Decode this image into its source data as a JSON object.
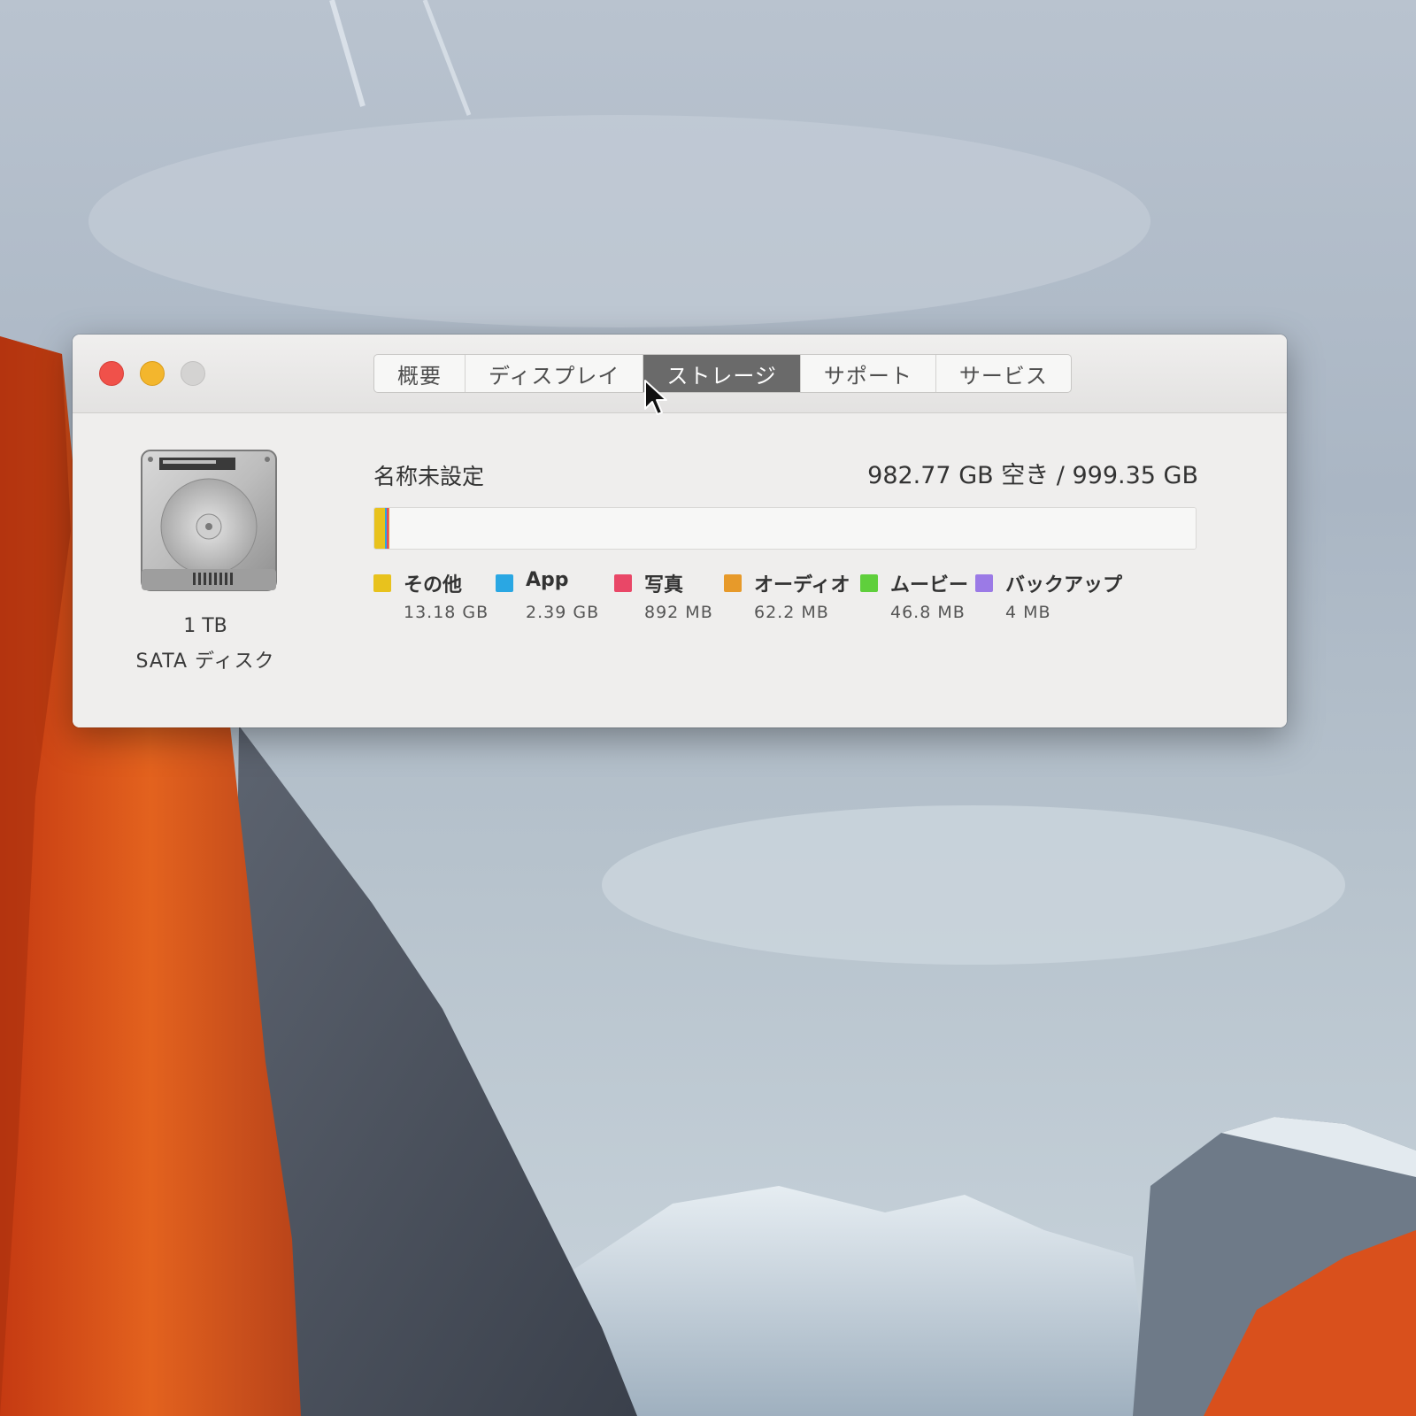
{
  "window": {
    "tabs": [
      {
        "label": "概要"
      },
      {
        "label": "ディスプレイ"
      },
      {
        "label": "ストレージ"
      },
      {
        "label": "サポート"
      },
      {
        "label": "サービス"
      }
    ],
    "active_tab": "ストレージ"
  },
  "disk": {
    "icon": "hard-disk-icon",
    "size_label": "1 TB",
    "type_label": "SATA ディスク"
  },
  "volume": {
    "name": "名称未設定",
    "capacity": "982.77 GB 空き / 999.35 GB"
  },
  "usage": {
    "categories": [
      {
        "label": "その他",
        "size": "13.18 GB",
        "color": "#e8c21d"
      },
      {
        "label": "App",
        "size": "2.39 GB",
        "color": "#2aa7e3"
      },
      {
        "label": "写真",
        "size": "892 MB",
        "color": "#e94767"
      },
      {
        "label": "オーディオ",
        "size": "62.2 MB",
        "color": "#e79a2a"
      },
      {
        "label": "ムービー",
        "size": "46.8 MB",
        "color": "#5fcf3c"
      },
      {
        "label": "バックアップ",
        "size": "4 MB",
        "color": "#9b7ae6"
      }
    ]
  },
  "colors": {
    "close": "#f0514a",
    "minimize": "#f3b62d",
    "zoom_disabled": "#d4d3d2",
    "active_tab": "#6a6a6a"
  }
}
